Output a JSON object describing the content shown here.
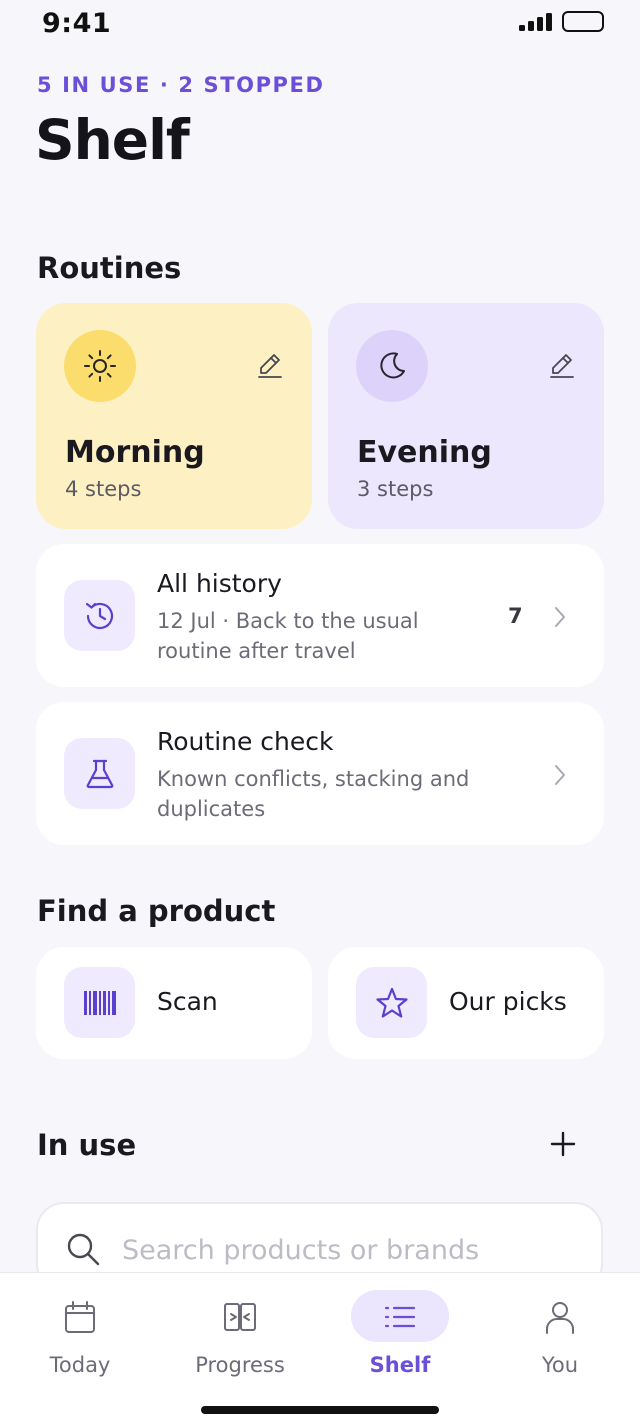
{
  "status": {
    "time": "9:41"
  },
  "header": {
    "overline": "5 IN USE · 2 STOPPED",
    "title": "Shelf"
  },
  "routines": {
    "section_title": "Routines",
    "cards": [
      {
        "name": "Morning",
        "steps": "4 steps",
        "icon": "sun-icon",
        "color": "#fdf1c4"
      },
      {
        "name": "Evening",
        "steps": "3 steps",
        "icon": "moon-icon",
        "color": "#ece7fc"
      }
    ]
  },
  "history": {
    "title": "All history",
    "subtitle": "12 Jul · Back to the usual routine after travel",
    "count": "7",
    "icon": "history-icon"
  },
  "routine_check": {
    "title": "Routine check",
    "subtitle": "Known conflicts, stacking and duplicates",
    "icon": "flask-icon"
  },
  "find": {
    "section_title": "Find a product",
    "items": [
      {
        "label": "Scan",
        "icon": "barcode-icon"
      },
      {
        "label": "Our picks",
        "icon": "star-icon"
      }
    ]
  },
  "in_use": {
    "section_title": "In use",
    "search_placeholder": "Search products or brands"
  },
  "tabs": [
    {
      "label": "Today",
      "icon": "calendar-icon",
      "active": false
    },
    {
      "label": "Progress",
      "icon": "compare-icon",
      "active": false
    },
    {
      "label": "Shelf",
      "icon": "list-icon",
      "active": true
    },
    {
      "label": "You",
      "icon": "user-icon",
      "active": false
    }
  ],
  "colors": {
    "accent": "#6b4fd8",
    "background": "#f7f6fb",
    "morning": "#fdf1c4",
    "evening": "#ece7fc"
  }
}
